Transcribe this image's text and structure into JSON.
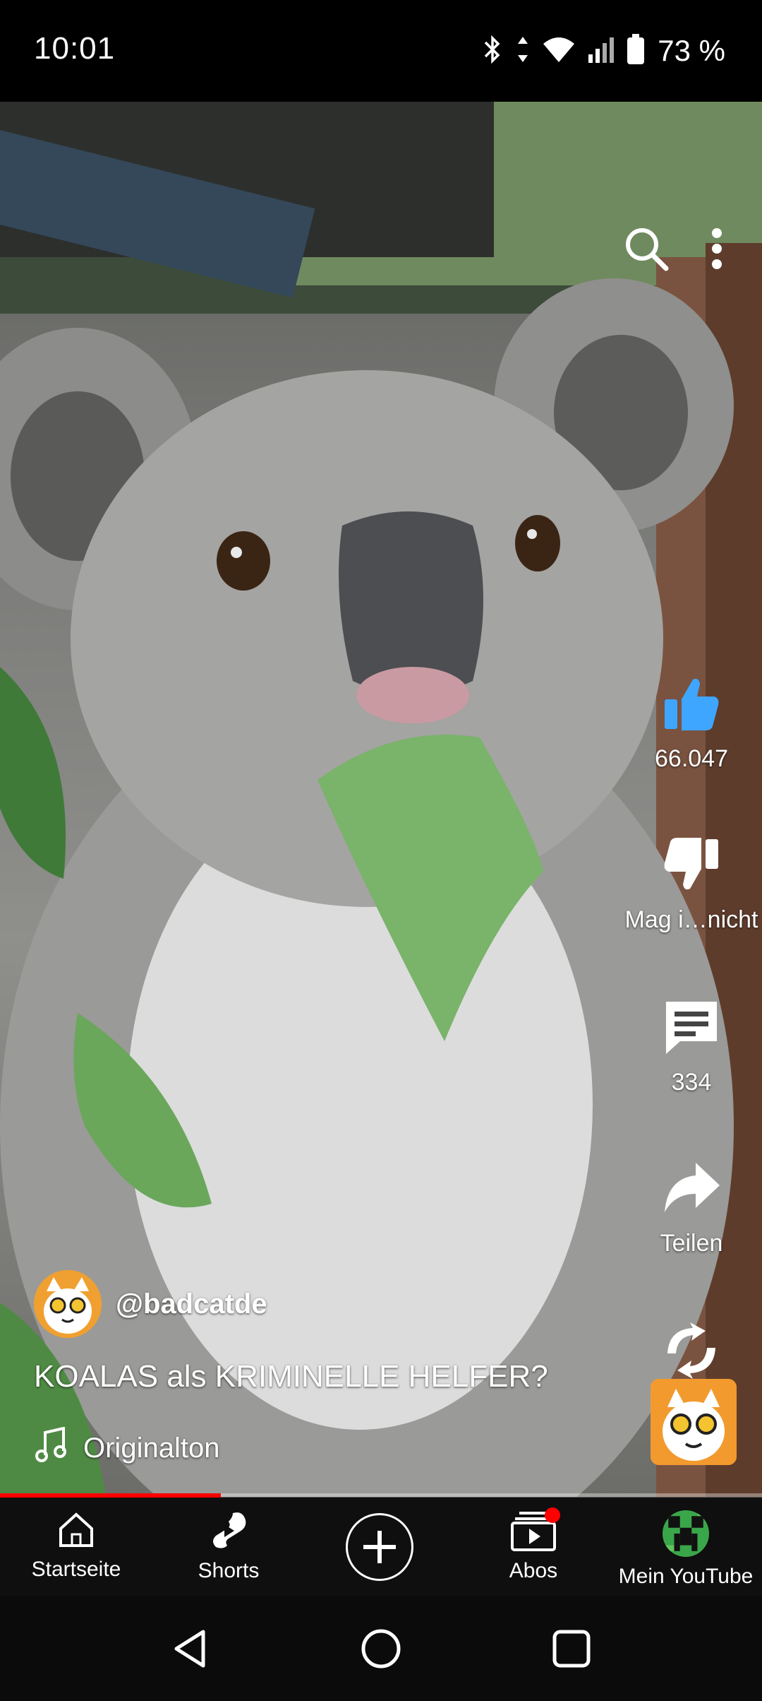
{
  "status_bar": {
    "time": "10:01",
    "battery": "73 %"
  },
  "video": {
    "likes": "66.047",
    "dislike_label": "Mag i…nicht",
    "comments": "334",
    "share_label": "Teilen",
    "remix_label": "Remix",
    "channel": "@badcatde",
    "title": "KOALAS als KRIMINELLE HELFER?",
    "sound": "Originalton",
    "progress_fraction": 0.29
  },
  "bottom_nav": {
    "items": [
      {
        "label": "Startseite"
      },
      {
        "label": "Shorts"
      },
      {
        "label": ""
      },
      {
        "label": "Abos"
      },
      {
        "label": "Mein YouTube"
      }
    ]
  },
  "colors": {
    "accent": "#ff0000",
    "like_blue": "#3ea6ff",
    "nav_bg": "#0f0f0f"
  }
}
